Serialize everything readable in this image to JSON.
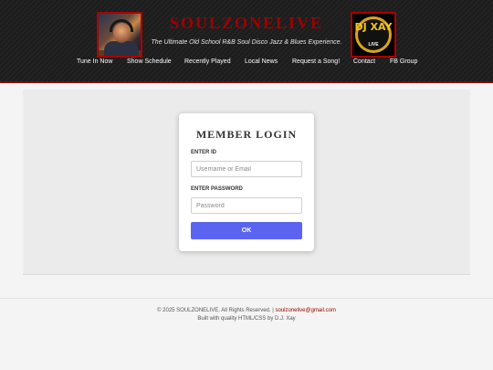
{
  "header": {
    "site_title": "SOULZONELIVE",
    "tagline": "The Ultimate Old School R&B Soul Disco Jazz & Blues Experience.",
    "logo_right": {
      "text": "DJ XAY",
      "subtext": "LIVE"
    }
  },
  "nav": {
    "items": [
      {
        "label": "Tune In Now"
      },
      {
        "label": "Show Schedule"
      },
      {
        "label": "Recently Played"
      },
      {
        "label": "Local News"
      },
      {
        "label": "Request a Song!"
      },
      {
        "label": "Contact"
      },
      {
        "label": "FB Group"
      }
    ]
  },
  "login": {
    "title": "MEMBER LOGIN",
    "id_label": "ENTER ID",
    "id_placeholder": "Username or Email",
    "password_label": "ENTER PASSWORD",
    "password_placeholder": "Password",
    "submit_label": "OK"
  },
  "footer": {
    "copyright": "© 2025 SOULZONELIVE. All Rights Reserved. |",
    "email": "soulzonelive@gmail.com",
    "credit": "Built with quality HTML/CSS by D.J. Xay"
  },
  "colors": {
    "brand_red": "#a00000",
    "button": "#5b64f0",
    "header_bg": "#1c1c1c"
  }
}
